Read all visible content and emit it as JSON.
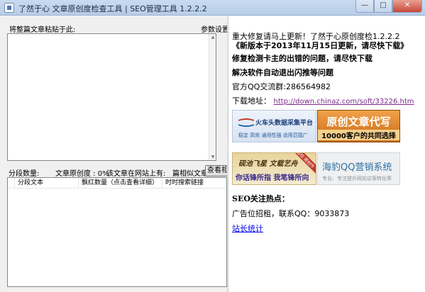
{
  "window": {
    "title": "了然于心 文章原创度检查工具 | SEO管理工具  1.2.2.2",
    "min_icon": "minimize-icon",
    "max_icon": "maximize-icon",
    "close_icon": "close-icon"
  },
  "left": {
    "paste_label": "将整篇文章粘贴于此:",
    "settings_link": "参数设置",
    "segment_count_label": "分段数量:",
    "originality_label": "文章原创度 : 0%",
    "site_exists_label": "该文章在网站上有:",
    "similar_label": "篇相似文章",
    "view_similar_button": "查看相似",
    "table_headers": [
      "分段文本",
      "飘红数量（点击查看详细）",
      "时时搜索链接"
    ]
  },
  "right": {
    "line1": "重大修复请马上更新！了然于心原创度检1.2.2.2",
    "line2": "《新版本于2013年11月15日更新，请尽快下载》",
    "line3": "修复检测卡主的出错的问题，请尽快下载",
    "line4": "解决软件自动退出闪推等问题",
    "qq_group": "官方QQ交流群:286564982",
    "download_label": "下载地址：",
    "download_url": "http://down.chinaz.com/soft/33226.htm",
    "ads": {
      "ad1_title": "火车头数据采集平台",
      "ad1_sub": "稳定  高效  通用性强  适用范围广",
      "ad2_line1": "原创文章代写",
      "ad2_line2": "10000客户的共同选择",
      "ad3_line1": "砚池飞星  文载艺舟",
      "ad3_line2": "你话锋所指  我笔锋所向",
      "ad3_badge": "版权·原创作",
      "ad4_title": "海豹QQ营销系统",
      "ad4_sub": "专业、专注提升网站访客转化率"
    },
    "seo_heading": "SEO关注热点：",
    "ad_contact": "广告位招租，联系QQ：9033873",
    "stats_link": "站长统计"
  }
}
